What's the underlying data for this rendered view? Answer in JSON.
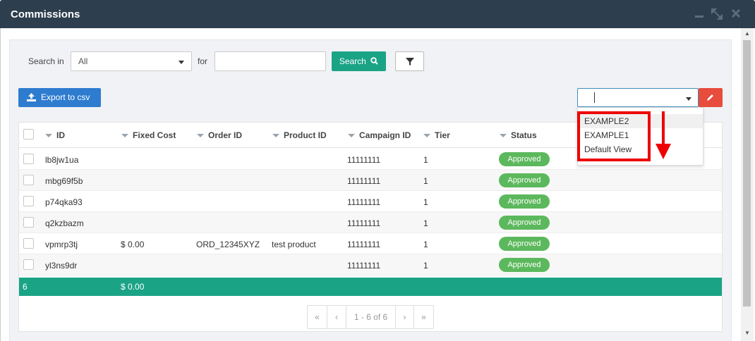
{
  "window": {
    "title": "Commissions"
  },
  "search": {
    "search_in_label": "Search in",
    "search_in_value": "All",
    "for_label": "for",
    "for_value": "",
    "search_button": "Search"
  },
  "toolbar": {
    "export_label": "Export to csv"
  },
  "view_select": {
    "value": "",
    "options": [
      "EXAMPLE2",
      "EXAMPLE1",
      "Default View"
    ]
  },
  "table": {
    "columns": [
      "ID",
      "Fixed Cost",
      "Order ID",
      "Product ID",
      "Campaign ID",
      "Tier",
      "Status"
    ],
    "rows": [
      {
        "id": "lb8jw1ua",
        "fixed_cost": "",
        "order_id": "",
        "product_id": "",
        "campaign_id": "11111111",
        "tier": "1",
        "status": "Approved"
      },
      {
        "id": "mbg69f5b",
        "fixed_cost": "",
        "order_id": "",
        "product_id": "",
        "campaign_id": "11111111",
        "tier": "1",
        "status": "Approved"
      },
      {
        "id": "p74qka93",
        "fixed_cost": "",
        "order_id": "",
        "product_id": "",
        "campaign_id": "11111111",
        "tier": "1",
        "status": "Approved"
      },
      {
        "id": "q2kzbazm",
        "fixed_cost": "",
        "order_id": "",
        "product_id": "",
        "campaign_id": "11111111",
        "tier": "1",
        "status": "Approved"
      },
      {
        "id": "vpmrp3tj",
        "fixed_cost": "$ 0.00",
        "order_id": "ORD_12345XYZ",
        "product_id": "test product",
        "campaign_id": "11111111",
        "tier": "1",
        "status": "Approved"
      },
      {
        "id": "yl3ns9dr",
        "fixed_cost": "",
        "order_id": "",
        "product_id": "",
        "campaign_id": "11111111",
        "tier": "1",
        "status": "Approved"
      }
    ],
    "footer": {
      "count": "6",
      "fixed_cost_total": "$ 0.00"
    }
  },
  "pager": {
    "first": "«",
    "prev": "‹",
    "info": "1 - 6 of 6",
    "next": "›",
    "last": "»"
  },
  "colors": {
    "titlebar": "#2d3e4e",
    "accent_green": "#1ba386",
    "status_approved": "#5cb85c",
    "export_blue": "#2e7ccf",
    "edit_red": "#e74c3c",
    "annotation_red": "#ee0000"
  }
}
